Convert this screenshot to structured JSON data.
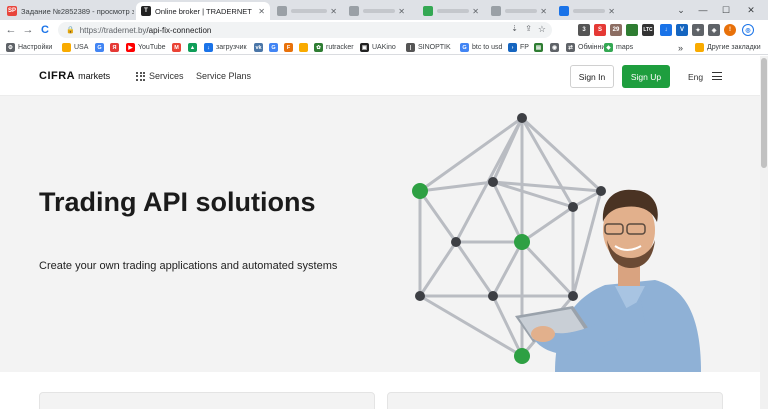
{
  "browser": {
    "tabs": [
      {
        "label": "Задание №2852389 - просмотр з",
        "favicon": "SP",
        "favicon_color": "#e8453c",
        "active": false
      },
      {
        "label": "Online broker | TRADERNET",
        "favicon": "T",
        "favicon_color": "#222222",
        "active": true
      },
      {
        "label": "",
        "favicon": "",
        "favicon_color": "#9aa0a6",
        "active": false
      },
      {
        "label": "",
        "favicon": "",
        "favicon_color": "#9aa0a6",
        "active": false
      },
      {
        "label": "",
        "favicon": "",
        "favicon_color": "#34a853",
        "active": false
      },
      {
        "label": "",
        "favicon": "",
        "favicon_color": "#9aa0a6",
        "active": false
      }
    ],
    "new_tab": "+",
    "window_controls": {
      "dropdown": "⌄",
      "minimize": "—",
      "maximize": "☐",
      "close": "✕"
    },
    "nav": {
      "back": "←",
      "forward": "→",
      "reload": "C"
    },
    "address": {
      "url_host": "https://tradernet.by",
      "url_path": "/api-fix-connection"
    },
    "extensions": [
      {
        "label": "3",
        "color": "#555555"
      },
      {
        "label": "S",
        "color": "#e53935"
      },
      {
        "label": "29",
        "color": "#8d6e63"
      },
      {
        "label": "LTC",
        "color": "#333333"
      },
      {
        "label": "↓",
        "color": "#1a73e8"
      },
      {
        "label": "V",
        "color": "#1565c0"
      },
      {
        "label": "✦",
        "color": "#5f6368"
      },
      {
        "label": "◈",
        "color": "#5f6368"
      },
      {
        "label": "!",
        "color": "#e8710a"
      }
    ],
    "bookmarks": [
      {
        "label": "Настройки",
        "icon": "gear-icon",
        "color": "#5f6368"
      },
      {
        "label": "USA",
        "icon": "folder-icon",
        "color": "#f9ab00"
      },
      {
        "label": "",
        "icon": "google-icon",
        "color": "#4285f4"
      },
      {
        "label": "",
        "icon": "yandex-icon",
        "color": "#e53935"
      },
      {
        "label": "YouTube",
        "icon": "youtube-icon",
        "color": "#ff0000"
      },
      {
        "label": "",
        "icon": "gmail-icon",
        "color": "#ea4335"
      },
      {
        "label": "",
        "icon": "drive-icon",
        "color": "#0f9d58"
      },
      {
        "label": "загрузчик",
        "icon": "download-icon",
        "color": "#1a73e8"
      },
      {
        "label": "",
        "icon": "vk-icon",
        "color": "#4a76a8"
      },
      {
        "label": "",
        "icon": "google-icon",
        "color": "#4285f4"
      },
      {
        "label": "",
        "icon": "f-icon",
        "color": "#e8710a"
      },
      {
        "label": "",
        "icon": "image-icon",
        "color": "#f9ab00"
      },
      {
        "label": "rutracker",
        "icon": "leaf-icon",
        "color": "#2e7d32"
      },
      {
        "label": "UAKino",
        "icon": "film-icon",
        "color": "#222222"
      },
      {
        "label": "SINOPTIK",
        "icon": "thermometer-icon",
        "color": "#555555"
      },
      {
        "label": "btc to usd",
        "icon": "google-icon",
        "color": "#4285f4"
      },
      {
        "label": "FP",
        "icon": "fp-icon",
        "color": "#1565c0"
      },
      {
        "label": "",
        "icon": "chart-icon",
        "color": "#2e7d32"
      },
      {
        "label": "",
        "icon": "eye-icon",
        "color": "#5f6368"
      },
      {
        "label": "Обмінник",
        "icon": "exchange-icon",
        "color": "#5f6368"
      },
      {
        "label": "maps",
        "icon": "map-pin-icon",
        "color": "#34a853"
      }
    ],
    "bookmarks_overflow": "»",
    "other_bookmarks": "Другие закладки"
  },
  "site": {
    "logo": {
      "brand": "CIFRA",
      "suffix": "markets"
    },
    "nav": {
      "services": "Services",
      "service_plans": "Service Plans"
    },
    "sign_in": "Sign In",
    "sign_up": "Sign Up",
    "language": "Eng",
    "hero": {
      "title": "Trading API solutions",
      "subtitle": "Create your own trading applications and automated systems"
    }
  },
  "colors": {
    "accent": "#1e9e3e",
    "hero_bg": "#f3f3f3"
  }
}
